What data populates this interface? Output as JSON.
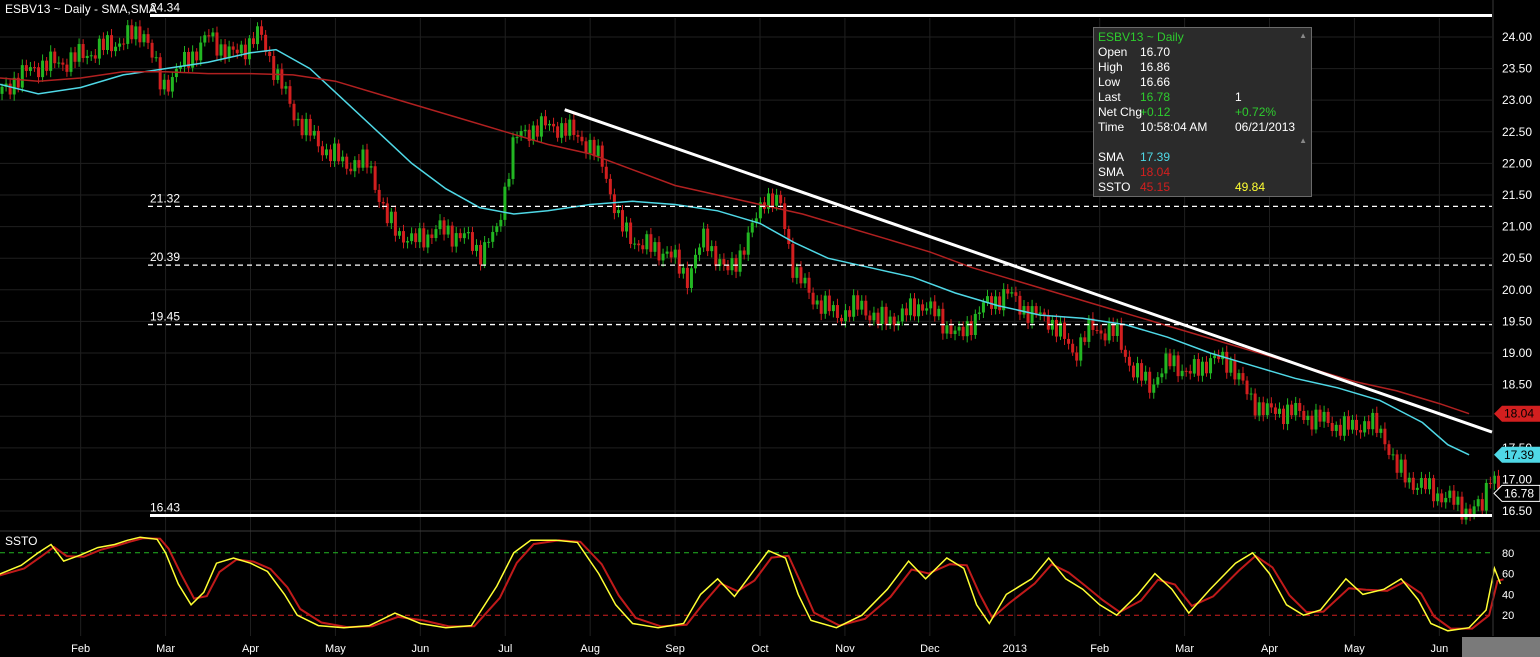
{
  "window": {
    "title": "ESBV13 ~ Daily  -  SMA,SMA",
    "indicator_title": "SSTO"
  },
  "legend": {
    "header": "ESBV13 ~ Daily",
    "rows": [
      {
        "label": "Open",
        "v1": "16.70",
        "v2": "",
        "c1": "#ffffff",
        "c2": "#ffffff"
      },
      {
        "label": "High",
        "v1": "16.86",
        "v2": "",
        "c1": "#ffffff",
        "c2": "#ffffff"
      },
      {
        "label": "Low",
        "v1": "16.66",
        "v2": "",
        "c1": "#ffffff",
        "c2": "#ffffff"
      },
      {
        "label": "Last",
        "v1": "16.78",
        "v2": "1",
        "c1": "#2ecc2e",
        "c2": "#ffffff"
      },
      {
        "label": "Net Chg",
        "v1": "+0.12",
        "v2": "+0.72%",
        "c1": "#2ecc2e",
        "c2": "#2ecc2e"
      },
      {
        "label": "Time",
        "v1": "10:58:04 AM",
        "v2": "06/21/2013",
        "c1": "#ffffff",
        "c2": "#ffffff"
      },
      {
        "label": "SMA",
        "v1": "17.39",
        "v2": "",
        "c1": "#4fd8e6",
        "c2": "#ffffff"
      },
      {
        "label": "SMA",
        "v1": "18.04",
        "v2": "",
        "c1": "#d21f1f",
        "c2": "#ffffff"
      },
      {
        "label": "SSTO",
        "v1": "45.15",
        "v2": "49.84",
        "c1": "#d21f1f",
        "c2": "#ffff33"
      }
    ]
  },
  "colors": {
    "background": "#000000",
    "up_candle": "#22b622",
    "down_candle": "#d21f1f",
    "sma_fast": "#4fd8e6",
    "sma_slow": "#b02020",
    "ssto_k": "#ffff33",
    "ssto_d": "#c01a1a",
    "grid": "#1f1f1f",
    "overbought": "#22b622",
    "oversold": "#d21f1f"
  },
  "chart_data": [
    {
      "type": "candlestick",
      "ylim": [
        16.2,
        24.3
      ],
      "y_ticks": [
        "24.00",
        "23.50",
        "23.00",
        "22.50",
        "22.00",
        "21.50",
        "21.00",
        "20.50",
        "20.00",
        "19.50",
        "19.00",
        "18.50",
        "18.00",
        "17.50",
        "17.00",
        "16.50"
      ],
      "x_labels": [
        "Feb",
        "Mar",
        "Apr",
        "May",
        "Jun",
        "Jul",
        "Aug",
        "Sep",
        "Oct",
        "Nov",
        "Dec",
        "2013",
        "Feb",
        "Mar",
        "Apr",
        "May",
        "Jun"
      ],
      "x_label_months": [
        1,
        2,
        3,
        4,
        5,
        6,
        7,
        8,
        9,
        10,
        11,
        12,
        13,
        14,
        15,
        16,
        17
      ],
      "x_range_months": [
        0.05,
        17.62
      ],
      "horizontal_levels": [
        {
          "label": "24.34",
          "value": 24.34,
          "style": "solid"
        },
        {
          "label": "21.32",
          "value": 21.32,
          "style": "dashed"
        },
        {
          "label": "20.39",
          "value": 20.39,
          "style": "dashed"
        },
        {
          "label": "19.45",
          "value": 19.45,
          "style": "dashed"
        },
        {
          "label": "16.43",
          "value": 16.43,
          "style": "solid"
        }
      ],
      "trendline": {
        "from": [
          6.7,
          22.85
        ],
        "to": [
          17.62,
          17.75
        ]
      },
      "price_anchors": [
        [
          0.05,
          23.1
        ],
        [
          0.2,
          23.3
        ],
        [
          0.5,
          23.55
        ],
        [
          0.8,
          23.6
        ],
        [
          1.1,
          23.75
        ],
        [
          1.4,
          23.9
        ],
        [
          1.75,
          24.1
        ],
        [
          1.95,
          23.2
        ],
        [
          2.2,
          23.55
        ],
        [
          2.5,
          24.0
        ],
        [
          2.8,
          23.7
        ],
        [
          3.1,
          24.05
        ],
        [
          3.3,
          23.45
        ],
        [
          3.5,
          22.8
        ],
        [
          3.8,
          22.3
        ],
        [
          4.1,
          22.0
        ],
        [
          4.4,
          22.0
        ],
        [
          4.6,
          21.1
        ],
        [
          4.9,
          20.75
        ],
        [
          5.2,
          20.95
        ],
        [
          5.5,
          20.85
        ],
        [
          5.7,
          20.6
        ],
        [
          5.9,
          20.9
        ],
        [
          6.1,
          22.35
        ],
        [
          6.3,
          22.55
        ],
        [
          6.6,
          22.6
        ],
        [
          6.9,
          22.4
        ],
        [
          7.15,
          22.0
        ],
        [
          7.35,
          21.0
        ],
        [
          7.6,
          20.7
        ],
        [
          7.9,
          20.6
        ],
        [
          8.15,
          20.2
        ],
        [
          8.35,
          20.85
        ],
        [
          8.6,
          20.25
        ],
        [
          8.85,
          20.75
        ],
        [
          9.05,
          21.5
        ],
        [
          9.25,
          21.3
        ],
        [
          9.4,
          20.3
        ],
        [
          9.6,
          19.9
        ],
        [
          9.9,
          19.6
        ],
        [
          10.2,
          19.75
        ],
        [
          10.4,
          19.5
        ],
        [
          10.7,
          19.6
        ],
        [
          10.9,
          19.8
        ],
        [
          11.15,
          19.5
        ],
        [
          11.35,
          19.25
        ],
        [
          11.6,
          19.7
        ],
        [
          11.9,
          19.95
        ],
        [
          12.2,
          19.6
        ],
        [
          12.4,
          19.55
        ],
        [
          12.7,
          19.0
        ],
        [
          12.9,
          19.4
        ],
        [
          13.2,
          19.3
        ],
        [
          13.4,
          18.7
        ],
        [
          13.6,
          18.5
        ],
        [
          13.85,
          18.9
        ],
        [
          14.05,
          18.65
        ],
        [
          14.3,
          18.9
        ],
        [
          14.55,
          18.85
        ],
        [
          14.75,
          18.3
        ],
        [
          15.0,
          18.05
        ],
        [
          15.2,
          18.1
        ],
        [
          15.45,
          18.0
        ],
        [
          15.7,
          17.9
        ],
        [
          15.9,
          17.8
        ],
        [
          16.15,
          17.9
        ],
        [
          16.35,
          17.7
        ],
        [
          16.5,
          17.15
        ],
        [
          16.7,
          16.95
        ],
        [
          16.95,
          16.8
        ],
        [
          17.15,
          16.65
        ],
        [
          17.35,
          16.5
        ],
        [
          17.5,
          16.55
        ],
        [
          17.6,
          17.15
        ],
        [
          17.72,
          16.8
        ]
      ],
      "series": [
        {
          "name": "SMA",
          "value": "17.39",
          "points": [
            [
              0.05,
              23.25
            ],
            [
              0.5,
              23.1
            ],
            [
              1.0,
              23.2
            ],
            [
              1.5,
              23.4
            ],
            [
              2.0,
              23.5
            ],
            [
              2.5,
              23.6
            ],
            [
              3.0,
              23.75
            ],
            [
              3.3,
              23.8
            ],
            [
              3.7,
              23.5
            ],
            [
              4.1,
              23.0
            ],
            [
              4.5,
              22.5
            ],
            [
              4.9,
              22.0
            ],
            [
              5.3,
              21.6
            ],
            [
              5.7,
              21.3
            ],
            [
              6.1,
              21.2
            ],
            [
              6.5,
              21.25
            ],
            [
              7.0,
              21.35
            ],
            [
              7.5,
              21.4
            ],
            [
              8.0,
              21.35
            ],
            [
              8.5,
              21.25
            ],
            [
              9.0,
              21.05
            ],
            [
              9.4,
              20.75
            ],
            [
              9.8,
              20.5
            ],
            [
              10.3,
              20.35
            ],
            [
              10.8,
              20.2
            ],
            [
              11.3,
              19.95
            ],
            [
              11.8,
              19.75
            ],
            [
              12.3,
              19.6
            ],
            [
              12.8,
              19.55
            ],
            [
              13.3,
              19.45
            ],
            [
              13.8,
              19.25
            ],
            [
              14.3,
              19.0
            ],
            [
              14.8,
              18.8
            ],
            [
              15.3,
              18.6
            ],
            [
              15.8,
              18.45
            ],
            [
              16.3,
              18.25
            ],
            [
              16.8,
              17.9
            ],
            [
              17.1,
              17.55
            ],
            [
              17.35,
              17.39
            ]
          ]
        },
        {
          "name": "SMA",
          "value": "18.04",
          "points": [
            [
              0.05,
              23.35
            ],
            [
              0.5,
              23.3
            ],
            [
              1.0,
              23.35
            ],
            [
              1.5,
              23.45
            ],
            [
              2.0,
              23.45
            ],
            [
              2.5,
              23.42
            ],
            [
              3.0,
              23.42
            ],
            [
              3.5,
              23.4
            ],
            [
              4.0,
              23.3
            ],
            [
              4.5,
              23.1
            ],
            [
              5.0,
              22.9
            ],
            [
              5.5,
              22.7
            ],
            [
              6.0,
              22.5
            ],
            [
              6.5,
              22.3
            ],
            [
              7.0,
              22.15
            ],
            [
              7.5,
              21.9
            ],
            [
              8.0,
              21.65
            ],
            [
              8.5,
              21.5
            ],
            [
              9.0,
              21.35
            ],
            [
              9.5,
              21.2
            ],
            [
              10.0,
              21.0
            ],
            [
              10.5,
              20.8
            ],
            [
              11.0,
              20.6
            ],
            [
              11.5,
              20.35
            ],
            [
              12.0,
              20.15
            ],
            [
              12.5,
              19.95
            ],
            [
              13.0,
              19.75
            ],
            [
              13.5,
              19.55
            ],
            [
              14.0,
              19.35
            ],
            [
              14.5,
              19.15
            ],
            [
              15.0,
              18.95
            ],
            [
              15.5,
              18.75
            ],
            [
              16.0,
              18.55
            ],
            [
              16.5,
              18.4
            ],
            [
              17.0,
              18.2
            ],
            [
              17.35,
              18.04
            ]
          ]
        }
      ],
      "price_tags": [
        {
          "label": "18.04",
          "value": 18.04,
          "color": "#d21f1f",
          "text_color": "#000000"
        },
        {
          "label": "17.39",
          "value": 17.39,
          "color": "#4fd8e6",
          "text_color": "#000000"
        },
        {
          "label": "16.78",
          "value": 16.78,
          "color": "#000000",
          "text_color": "#ffffff"
        }
      ]
    },
    {
      "type": "line",
      "name": "SSTO",
      "ylim": [
        0,
        100
      ],
      "y_ticks": [
        "80",
        "60",
        "40",
        "20"
      ],
      "reference_lines": [
        {
          "value": 80,
          "color": "#22b622"
        },
        {
          "value": 20,
          "color": "#d21f1f"
        }
      ],
      "series": [
        {
          "name": "SSTO",
          "value": "49.84",
          "points": [
            [
              0.0,
              58
            ],
            [
              0.3,
              68
            ],
            [
              0.5,
              80
            ],
            [
              0.65,
              88
            ],
            [
              0.8,
              72
            ],
            [
              1.0,
              78
            ],
            [
              1.2,
              85
            ],
            [
              1.4,
              88
            ],
            [
              1.55,
              92
            ],
            [
              1.7,
              95
            ],
            [
              1.9,
              93
            ],
            [
              2.0,
              80
            ],
            [
              2.15,
              50
            ],
            [
              2.3,
              30
            ],
            [
              2.45,
              42
            ],
            [
              2.6,
              70
            ],
            [
              2.8,
              75
            ],
            [
              3.0,
              70
            ],
            [
              3.2,
              62
            ],
            [
              3.4,
              40
            ],
            [
              3.55,
              20
            ],
            [
              3.8,
              10
            ],
            [
              4.1,
              8
            ],
            [
              4.4,
              10
            ],
            [
              4.7,
              22
            ],
            [
              5.0,
              12
            ],
            [
              5.3,
              8
            ],
            [
              5.6,
              10
            ],
            [
              5.9,
              48
            ],
            [
              6.1,
              80
            ],
            [
              6.3,
              92
            ],
            [
              6.6,
              92
            ],
            [
              6.85,
              90
            ],
            [
              7.1,
              60
            ],
            [
              7.3,
              30
            ],
            [
              7.5,
              12
            ],
            [
              7.8,
              8
            ],
            [
              8.1,
              12
            ],
            [
              8.3,
              40
            ],
            [
              8.5,
              55
            ],
            [
              8.7,
              38
            ],
            [
              8.9,
              60
            ],
            [
              9.1,
              82
            ],
            [
              9.3,
              75
            ],
            [
              9.45,
              40
            ],
            [
              9.6,
              15
            ],
            [
              9.9,
              8
            ],
            [
              10.2,
              20
            ],
            [
              10.5,
              45
            ],
            [
              10.75,
              72
            ],
            [
              10.95,
              55
            ],
            [
              11.2,
              75
            ],
            [
              11.4,
              65
            ],
            [
              11.55,
              30
            ],
            [
              11.7,
              12
            ],
            [
              11.9,
              40
            ],
            [
              12.2,
              55
            ],
            [
              12.4,
              75
            ],
            [
              12.6,
              55
            ],
            [
              12.8,
              45
            ],
            [
              13.0,
              30
            ],
            [
              13.2,
              20
            ],
            [
              13.45,
              40
            ],
            [
              13.65,
              60
            ],
            [
              13.85,
              45
            ],
            [
              14.05,
              22
            ],
            [
              14.3,
              45
            ],
            [
              14.6,
              70
            ],
            [
              14.8,
              80
            ],
            [
              15.0,
              60
            ],
            [
              15.2,
              30
            ],
            [
              15.4,
              20
            ],
            [
              15.6,
              25
            ],
            [
              15.9,
              55
            ],
            [
              16.1,
              40
            ],
            [
              16.35,
              45
            ],
            [
              16.55,
              55
            ],
            [
              16.75,
              35
            ],
            [
              16.9,
              12
            ],
            [
              17.1,
              5
            ],
            [
              17.35,
              8
            ],
            [
              17.55,
              25
            ],
            [
              17.65,
              65
            ],
            [
              17.72,
              50
            ]
          ]
        }
      ]
    }
  ]
}
